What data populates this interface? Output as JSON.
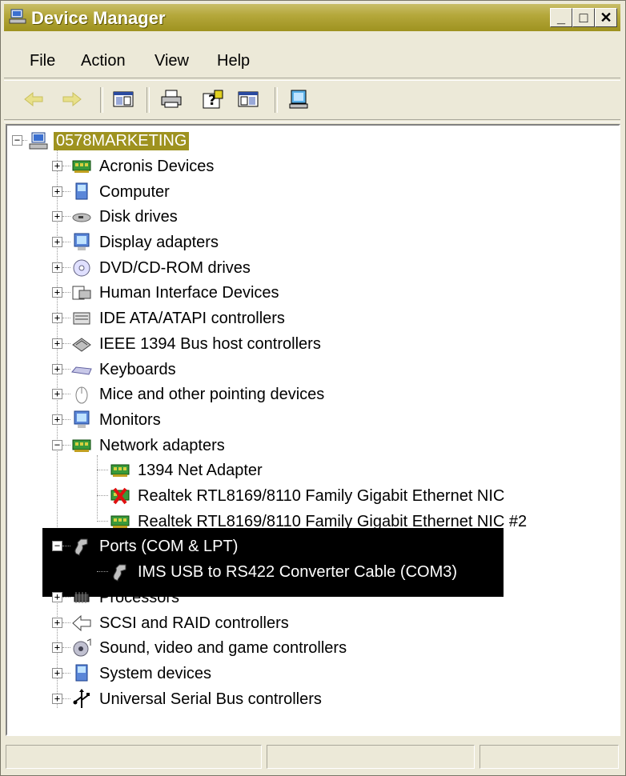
{
  "window": {
    "title": "Device Manager",
    "controls": {
      "minimize": "_",
      "maximize": "□",
      "close": "✕"
    }
  },
  "menu": [
    "File",
    "Action",
    "View",
    "Help"
  ],
  "toolbar": {
    "icons": [
      "back-arrow-icon",
      "forward-arrow-icon",
      "show-hide-tree-icon",
      "print-icon",
      "help-icon",
      "properties-icon",
      "scan-hardware-icon"
    ]
  },
  "tree": {
    "root": "0578MARKETING",
    "categories": [
      {
        "label": "Acronis Devices",
        "icon": "network-card-icon",
        "expanded": false
      },
      {
        "label": "Computer",
        "icon": "computer-icon",
        "expanded": false
      },
      {
        "label": "Disk drives",
        "icon": "disk-drive-icon",
        "expanded": false
      },
      {
        "label": "Display adapters",
        "icon": "display-icon",
        "expanded": false
      },
      {
        "label": "DVD/CD-ROM drives",
        "icon": "cdrom-icon",
        "expanded": false
      },
      {
        "label": "Human Interface Devices",
        "icon": "hid-icon",
        "expanded": false
      },
      {
        "label": "IDE ATA/ATAPI controllers",
        "icon": "ide-icon",
        "expanded": false
      },
      {
        "label": "IEEE 1394 Bus host controllers",
        "icon": "ieee1394-icon",
        "expanded": false
      },
      {
        "label": "Keyboards",
        "icon": "keyboard-icon",
        "expanded": false
      },
      {
        "label": "Mice and other pointing devices",
        "icon": "mouse-icon",
        "expanded": false
      },
      {
        "label": "Monitors",
        "icon": "monitor-icon",
        "expanded": false
      },
      {
        "label": "Network adapters",
        "icon": "network-card-icon",
        "expanded": true,
        "children": [
          {
            "label": "1394 Net Adapter",
            "icon": "network-card-icon"
          },
          {
            "label": "Realtek RTL8169/8110 Family Gigabit Ethernet NIC",
            "icon": "network-card-disabled-icon"
          },
          {
            "label": "Realtek RTL8169/8110 Family Gigabit Ethernet NIC #2",
            "icon": "network-card-icon"
          }
        ]
      },
      {
        "label": "Ports (COM & LPT)",
        "icon": "port-icon",
        "expanded": true,
        "children": [
          {
            "label": "IMS USB to RS422 Converter Cable (COM3)",
            "icon": "port-icon"
          }
        ]
      },
      {
        "label": "Processors",
        "icon": "processor-icon",
        "expanded": false
      },
      {
        "label": "SCSI and RAID controllers",
        "icon": "scsi-icon",
        "expanded": false
      },
      {
        "label": "Sound, video and game controllers",
        "icon": "sound-icon",
        "expanded": false
      },
      {
        "label": "System devices",
        "icon": "system-icon",
        "expanded": false
      },
      {
        "label": "Universal Serial Bus controllers",
        "icon": "usb-icon",
        "expanded": false
      }
    ]
  },
  "colors": {
    "title_bar": "#b5a83c",
    "selection": "#9e921f",
    "highlight_box": "#000000"
  }
}
